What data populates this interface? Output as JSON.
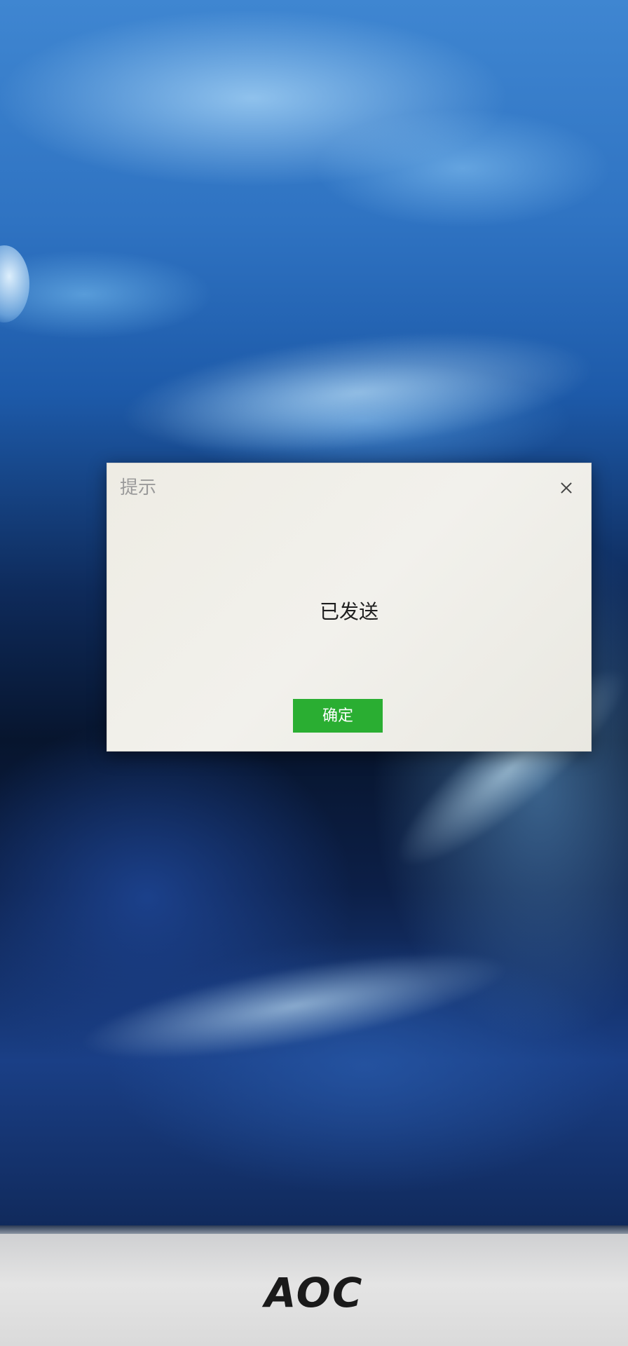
{
  "dialog": {
    "title": "提示",
    "message": "已发送",
    "confirm_label": "确定"
  },
  "monitor": {
    "brand_logo": "AOC"
  },
  "colors": {
    "confirm_button": "#2aae32",
    "dialog_background": "#efede6"
  },
  "icons": {
    "close": "close-icon"
  }
}
